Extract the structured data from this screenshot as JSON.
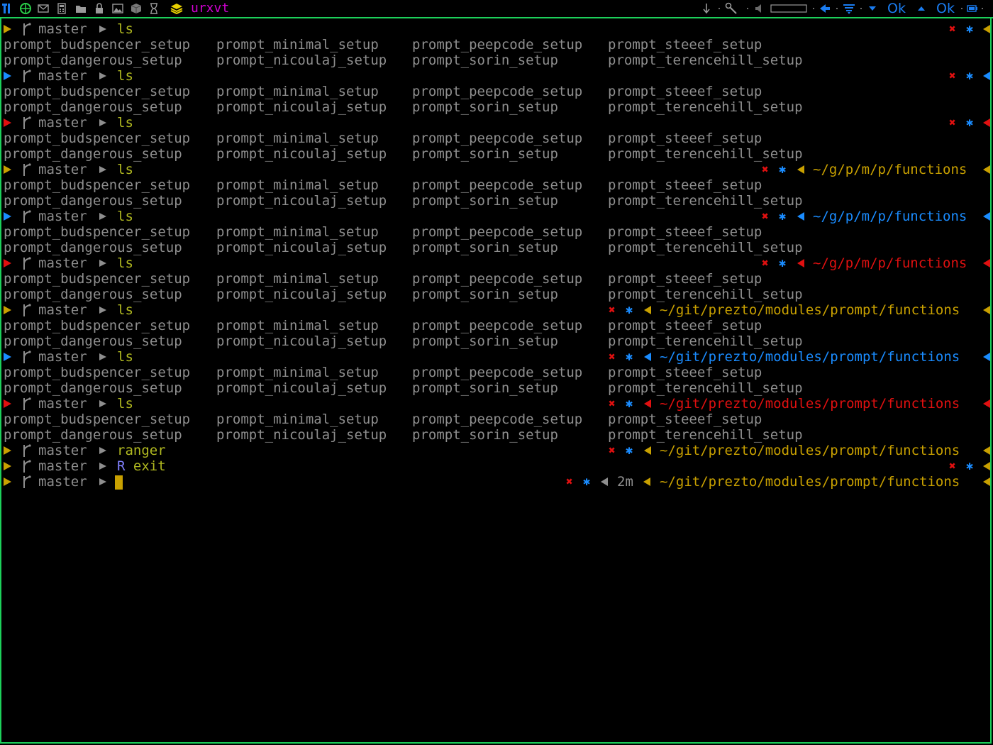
{
  "panel": {
    "window_title": "urxvt",
    "status": [
      "Ok",
      "Ok"
    ],
    "icons": [
      "tools-icon",
      "globe-icon",
      "mail-icon",
      "calculator-icon",
      "folder-icon",
      "lock-icon",
      "image-icon",
      "package-icon",
      "hourglass-icon",
      "layers-icon",
      "download-arrow-icon",
      "wrench-icon",
      "volume-icon",
      "volume-slider",
      "network-back-icon",
      "wifi-icon",
      "dropdown-icon",
      "up-icon",
      "battery-icon"
    ],
    "accent": "#1cd05a"
  },
  "prompt": {
    "branch": "master",
    "short_path": "~/g/p/m/p/functions",
    "long_path": "~/git/prezto/modules/prompt/functions",
    "duration": "2m",
    "x_mark": "✖",
    "star_mark": "✱",
    "colors": {
      "yellow": "#c8a000",
      "blue": "#1a8cff",
      "red": "#e01010"
    }
  },
  "listing": {
    "col1": [
      "prompt_budspencer_setup",
      "prompt_dangerous_setup"
    ],
    "col2": [
      "prompt_minimal_setup",
      "prompt_nicoulaj_setup"
    ],
    "col3": [
      "prompt_peepcode_setup",
      "prompt_sorin_setup"
    ],
    "col4": [
      "prompt_steeef_setup",
      "prompt_terencehill_setup"
    ]
  },
  "blocks": [
    {
      "cmd": "ls",
      "color": "yellow",
      "path": "none"
    },
    {
      "cmd": "ls",
      "color": "blue",
      "path": "none"
    },
    {
      "cmd": "ls",
      "color": "red",
      "path": "none"
    },
    {
      "cmd": "ls",
      "color": "yellow",
      "path": "short"
    },
    {
      "cmd": "ls",
      "color": "blue",
      "path": "short"
    },
    {
      "cmd": "ls",
      "color": "red",
      "path": "short"
    },
    {
      "cmd": "ls",
      "color": "yellow",
      "path": "long"
    },
    {
      "cmd": "ls",
      "color": "blue",
      "path": "long"
    },
    {
      "cmd": "ls",
      "color": "red",
      "path": "long"
    }
  ],
  "tail": [
    {
      "cmd": "ranger",
      "color": "yellow",
      "path": "long"
    },
    {
      "cmd": "R exit",
      "color": "yellow",
      "path": "none"
    },
    {
      "cmd": "",
      "color": "yellow",
      "path": "long-duration",
      "cursor": true
    }
  ]
}
